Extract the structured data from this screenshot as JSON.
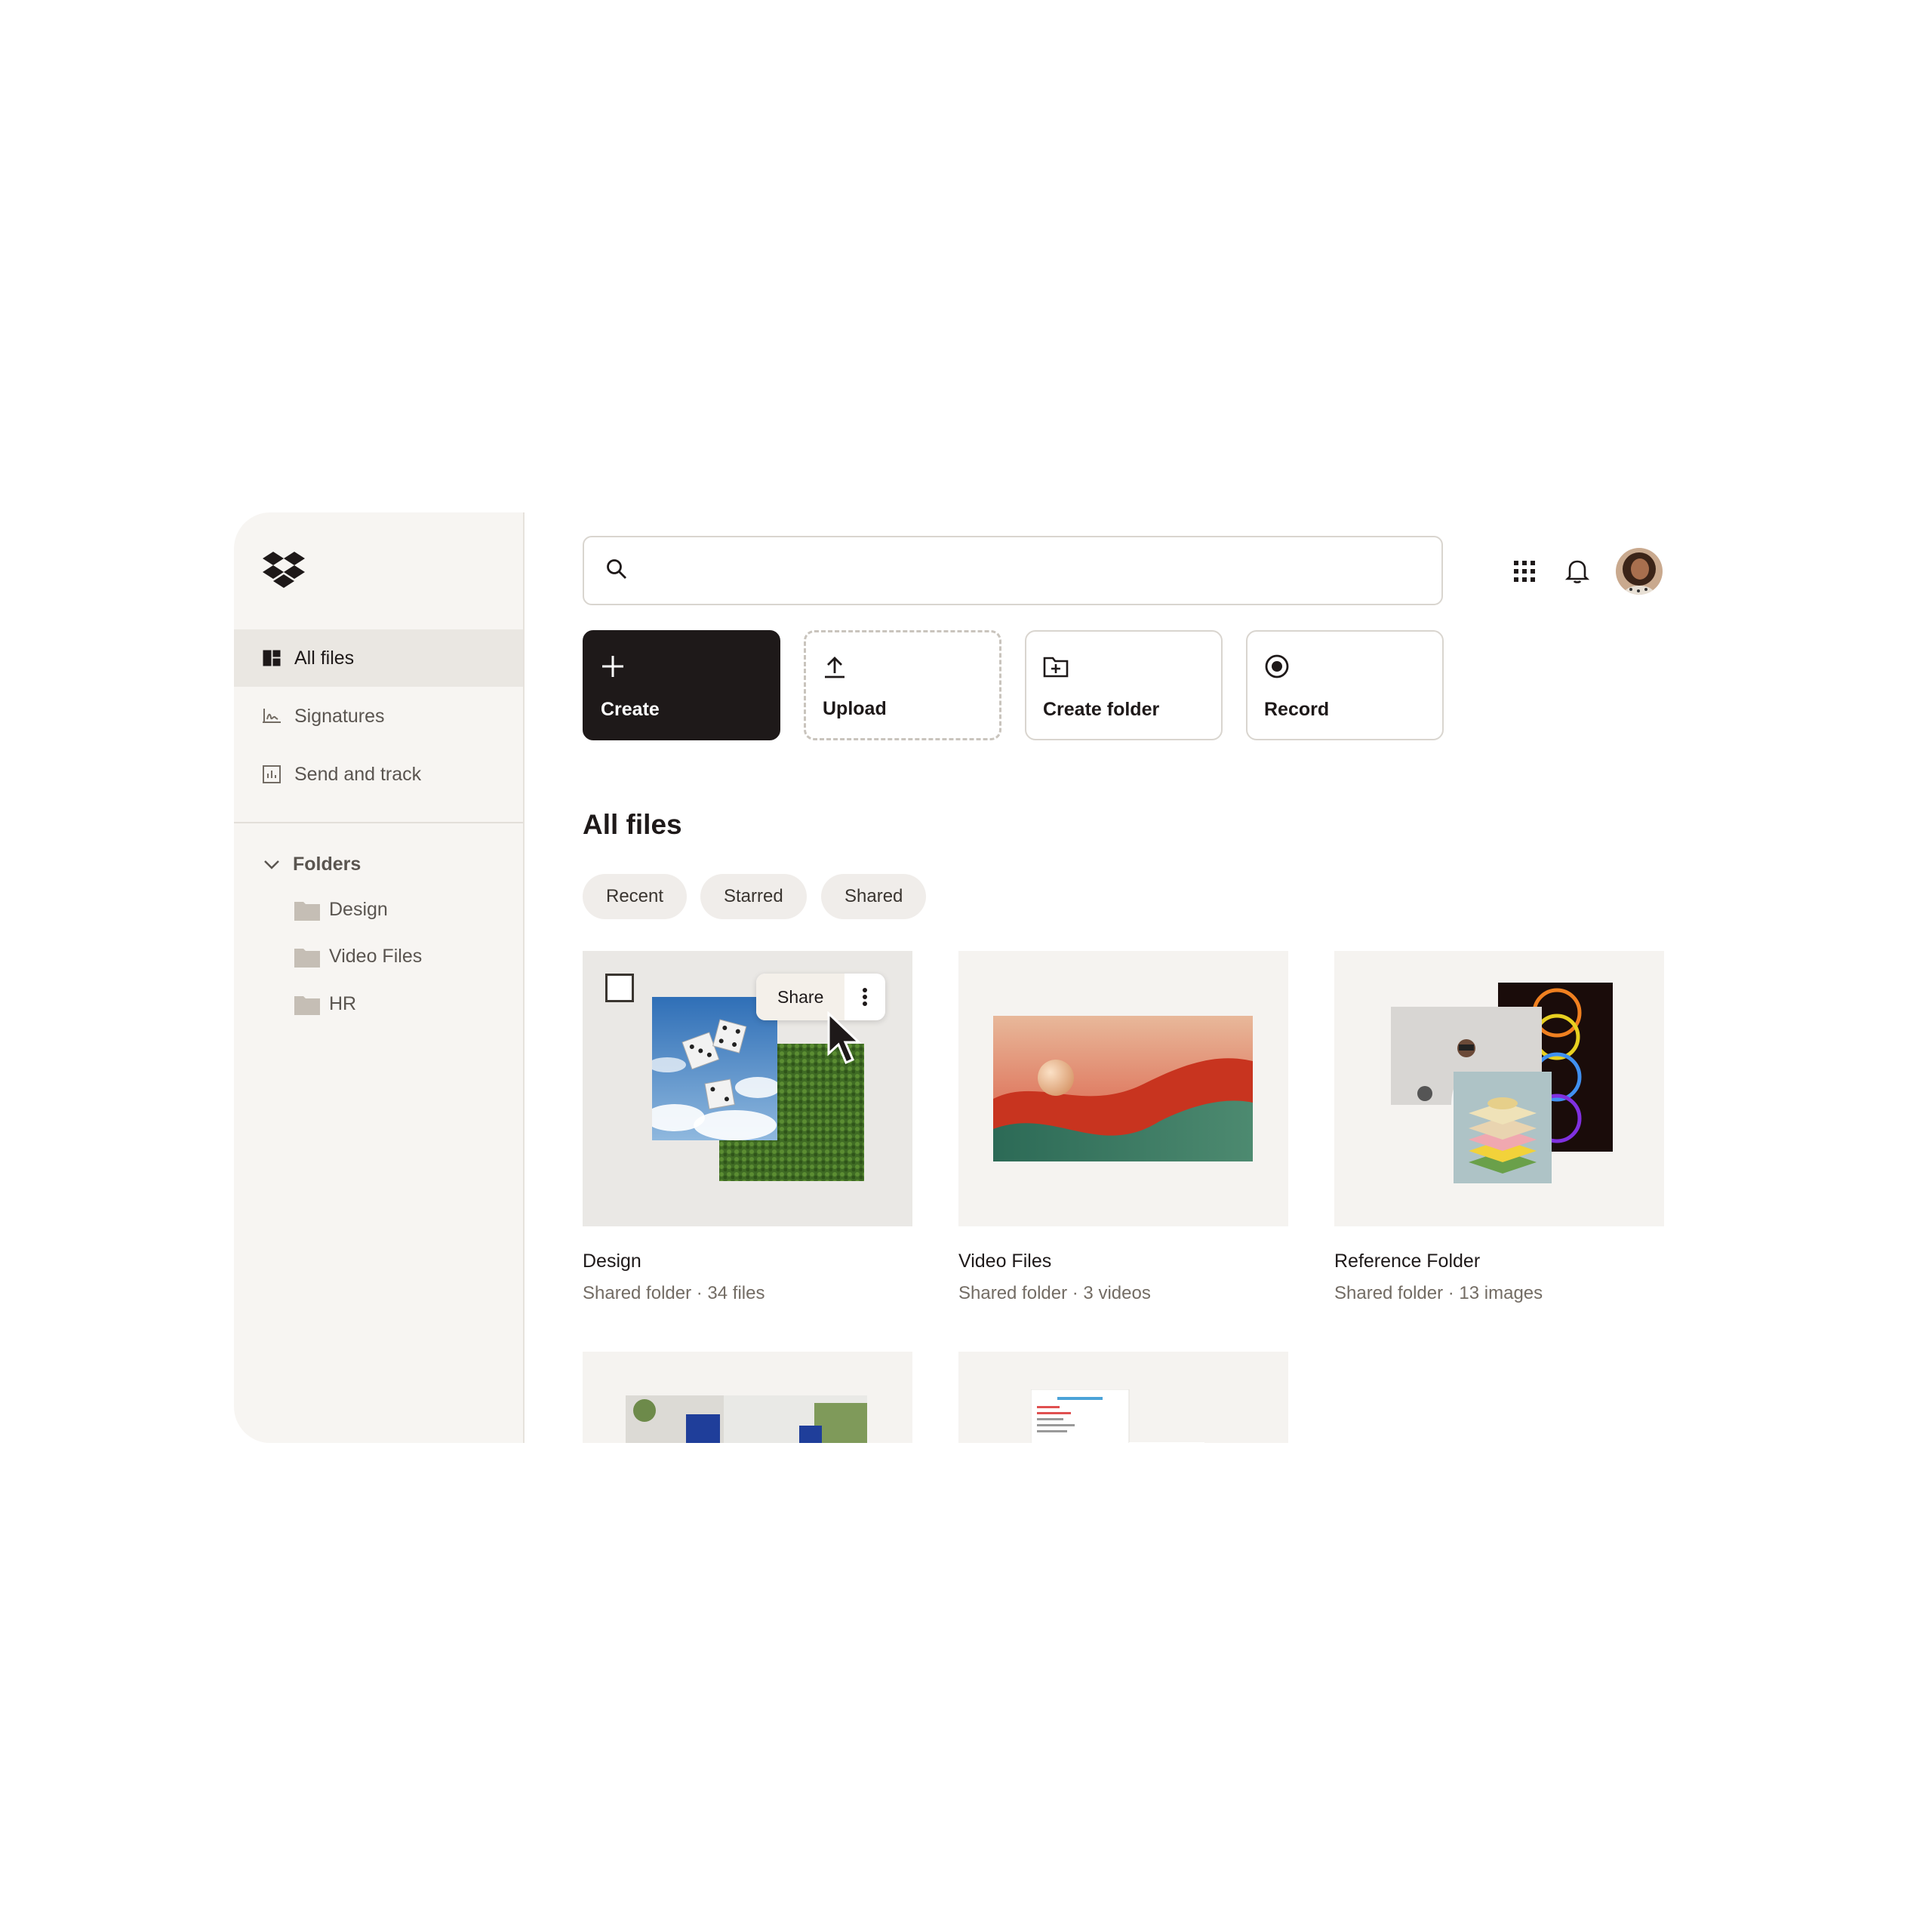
{
  "sidebar": {
    "nav": [
      {
        "label": "All files",
        "icon": "all-files-icon",
        "active": true
      },
      {
        "label": "Signatures",
        "icon": "signature-icon",
        "active": false
      },
      {
        "label": "Send and track",
        "icon": "send-track-icon",
        "active": false
      }
    ],
    "folders_label": "Folders",
    "folders": [
      {
        "label": "Design"
      },
      {
        "label": "Video Files"
      },
      {
        "label": "HR"
      }
    ]
  },
  "search": {
    "placeholder": ""
  },
  "actions": [
    {
      "label": "Create",
      "icon": "plus-icon"
    },
    {
      "label": "Upload",
      "icon": "upload-icon"
    },
    {
      "label": "Create folder",
      "icon": "folder-plus-icon"
    },
    {
      "label": "Record",
      "icon": "record-icon"
    }
  ],
  "main": {
    "title": "All files",
    "filters": [
      "Recent",
      "Starred",
      "Shared"
    ],
    "cards": [
      {
        "name": "Design",
        "meta": "Shared folder · 34 files"
      },
      {
        "name": "Video Files",
        "meta": "Shared folder · 3 videos"
      },
      {
        "name": "Reference Folder",
        "meta": "Shared folder · 13 images"
      }
    ],
    "share_label": "Share"
  },
  "colors": {
    "accent_dark": "#1e1919",
    "sidebar_bg": "#f7f5f2"
  }
}
